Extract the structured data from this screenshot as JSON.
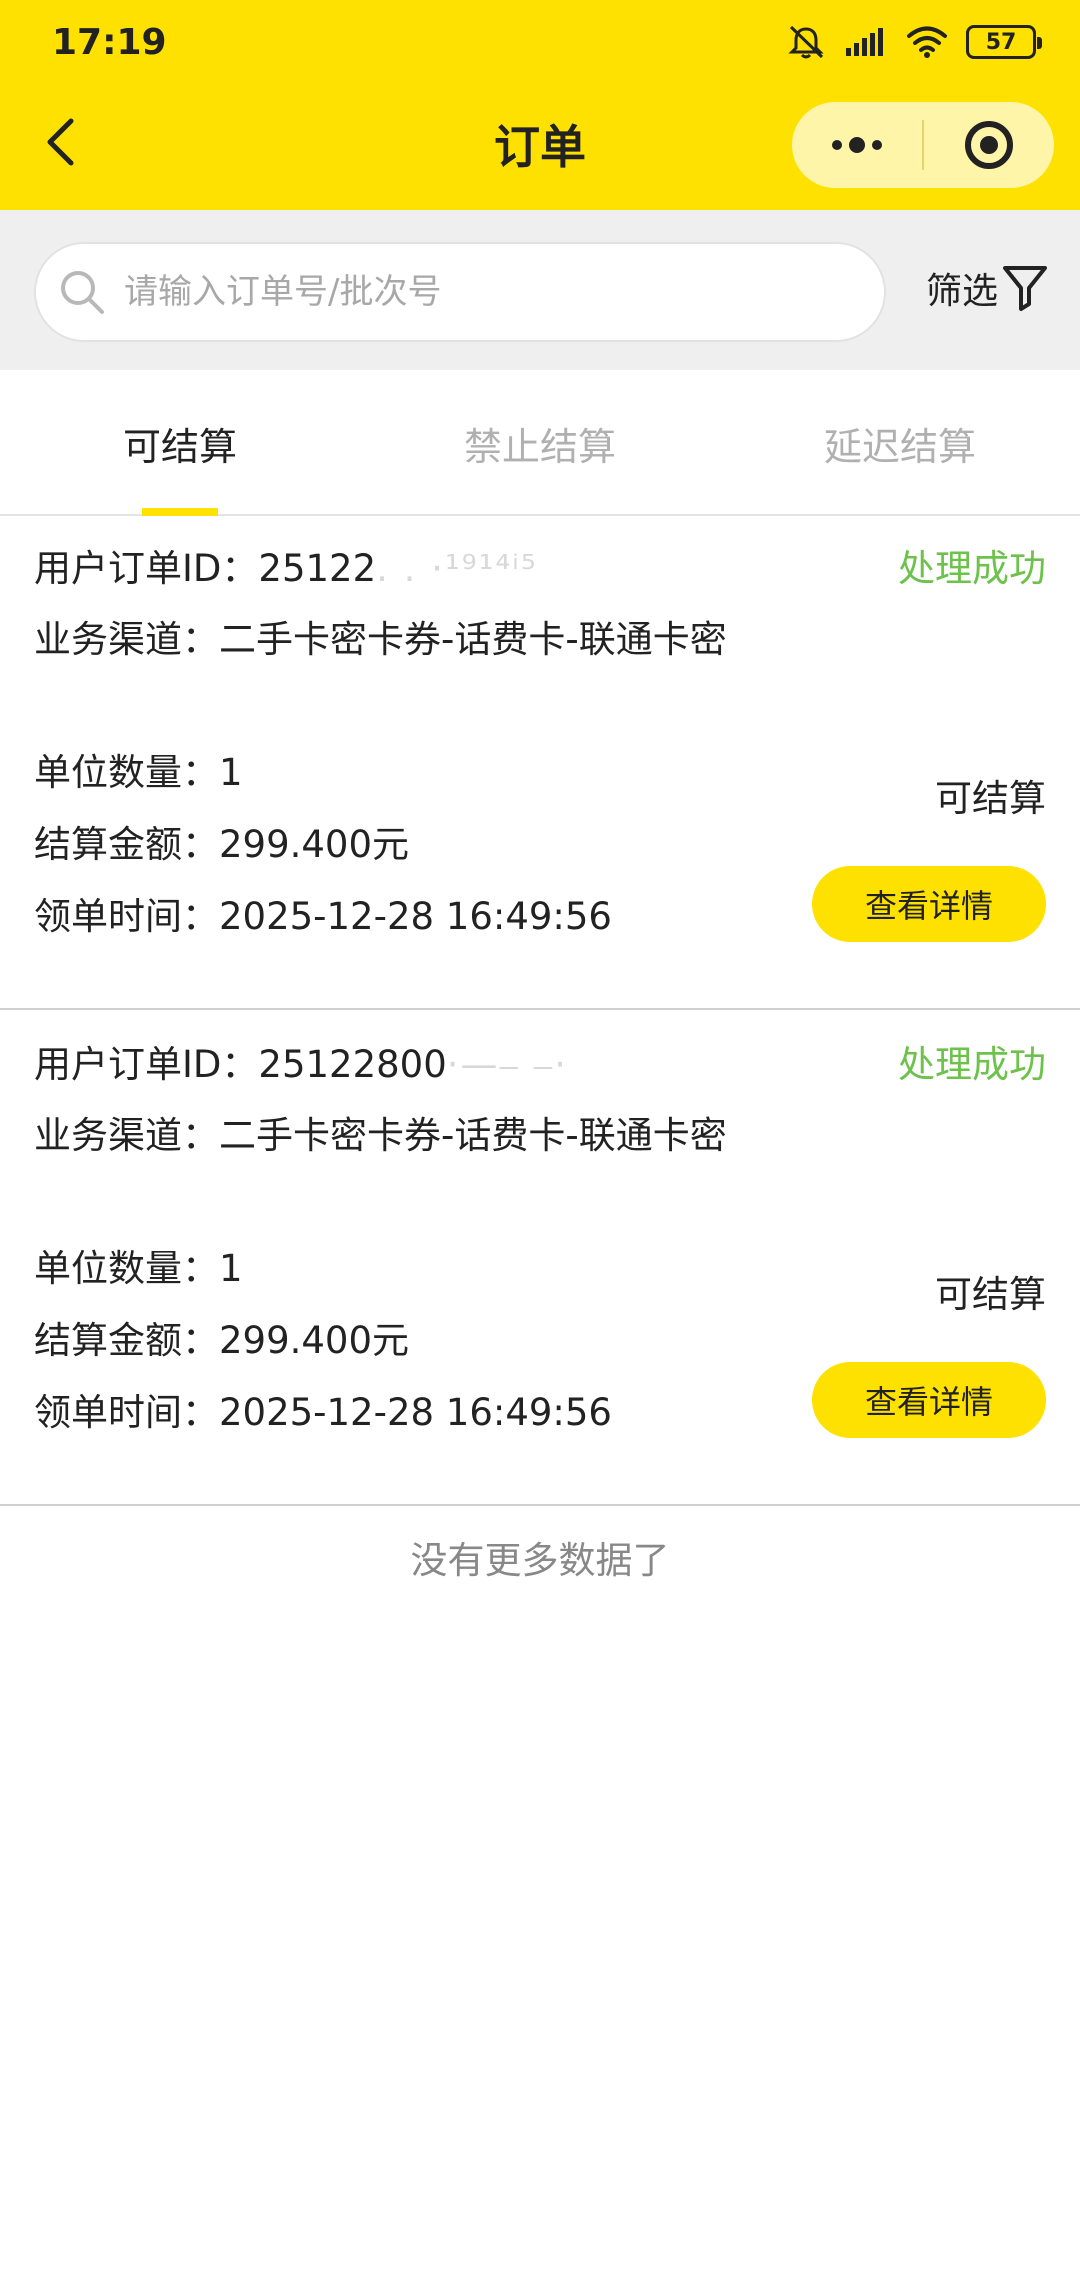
{
  "status_bar": {
    "time": "17:19",
    "battery": "57"
  },
  "nav": {
    "title": "订单"
  },
  "search": {
    "placeholder": "请输入订单号/批次号",
    "filter_label": "筛选"
  },
  "tabs": [
    {
      "label": "可结算",
      "active": true
    },
    {
      "label": "禁止结算",
      "active": false
    },
    {
      "label": "延迟结算",
      "active": false
    }
  ],
  "orders": [
    {
      "order_id_label": "用户订单ID：",
      "order_id": "25122",
      "order_id_mask": ". .  ·¹⁹¹⁴ⁱ⁵",
      "status": "处理成功",
      "channel": "业务渠道：二手卡密卡券-话费卡-联通卡密",
      "quantity": "单位数量：1",
      "amount": "结算金额：299.400元",
      "time": "领单时间：2025-12-28 16:49:56",
      "settle_status": "可结算",
      "detail_button": "查看详情"
    },
    {
      "order_id_label": "用户订单ID：",
      "order_id": "25122800",
      "order_id_mask": "·—⎯ ⎯·",
      "status": "处理成功",
      "channel": "业务渠道：二手卡密卡券-话费卡-联通卡密",
      "quantity": "单位数量：1",
      "amount": "结算金额：299.400元",
      "time": "领单时间：2025-12-28 16:49:56",
      "settle_status": "可结算",
      "detail_button": "查看详情"
    }
  ],
  "footer": {
    "no_more": "没有更多数据了"
  },
  "colors": {
    "brand_yellow": "#ffe100",
    "success_green": "#6cc24a"
  },
  "icons": [
    "back-arrow-icon",
    "more-dots-icon",
    "target-circle-icon",
    "search-icon",
    "filter-funnel-icon",
    "mute-icon",
    "signal-icon",
    "wifi-icon",
    "battery-icon"
  ]
}
